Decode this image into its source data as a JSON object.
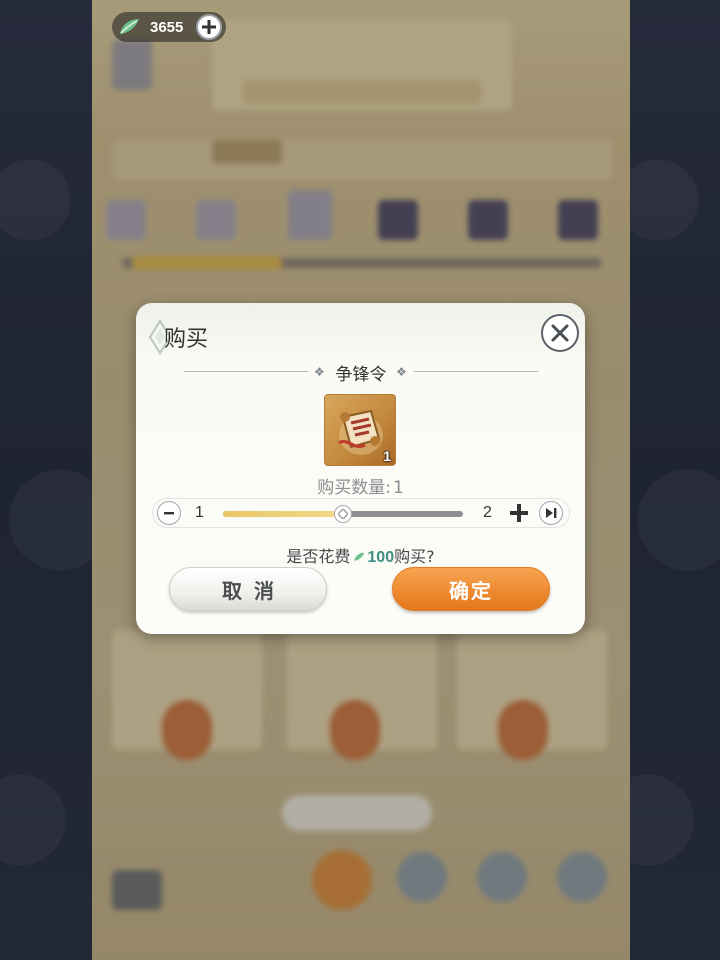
{
  "currency": {
    "amount": "3655",
    "icon": "jade-leaf-icon",
    "plus_icon": "plus-icon"
  },
  "modal": {
    "title": "购买",
    "item_name": "争锋令",
    "item_count": "1",
    "quantity_label": "购买数量:",
    "quantity_value": "1",
    "slider": {
      "min": "1",
      "max": "2",
      "value": 1,
      "fill_fraction": 0.5
    },
    "confirm_prefix": "是否花费",
    "cost": "100",
    "confirm_suffix": "购买?",
    "cancel_label": "取消",
    "ok_label": "确定"
  },
  "colors": {
    "accent_orange": "#ee8a30",
    "slider_fill": "#e9c766",
    "cost_teal": "#3f8f84"
  }
}
